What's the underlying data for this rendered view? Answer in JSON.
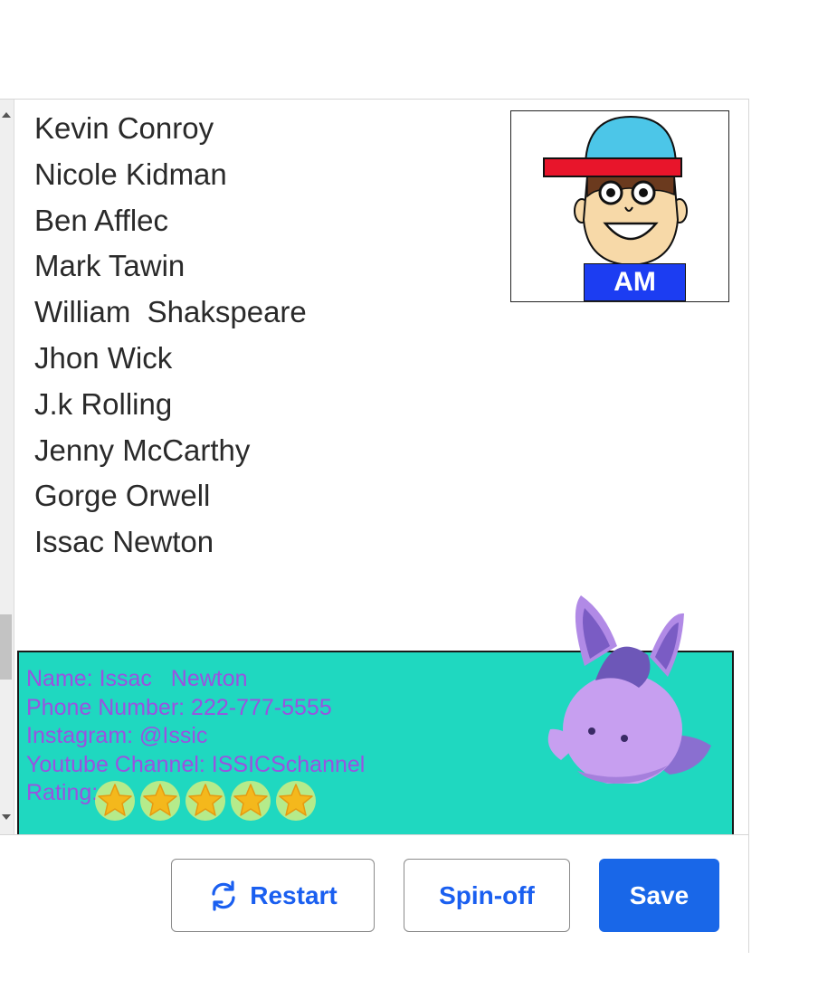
{
  "names": [
    "Kevin Conroy",
    "Nicole Kidman",
    "Ben Afflec",
    "Mark Tawin",
    "William  Shakspeare",
    "Jhon Wick",
    "J.k Rolling",
    "Jenny McCarthy",
    "Gorge Orwell",
    "Issac Newton"
  ],
  "avatar": {
    "badge": "AM",
    "icon": "cartoon-boy-avatar-icon"
  },
  "card": {
    "name_line": "Name: Issac   Newton",
    "phone_line": "Phone Number: 222-777-5555",
    "instagram_line": "Instagram: @Issic",
    "youtube_line": "Youtube Channel: ISSICSchannel",
    "rating_label": "Rating:",
    "rating": 5,
    "rating_max": 5,
    "mascot_icon": "purple-creature-icon",
    "background_color": "#1fd8c0",
    "text_color": "#9a52e0"
  },
  "footer": {
    "restart_label": "Restart",
    "spinoff_label": "Spin-off",
    "save_label": "Save",
    "accent_color": "#1967e8"
  }
}
